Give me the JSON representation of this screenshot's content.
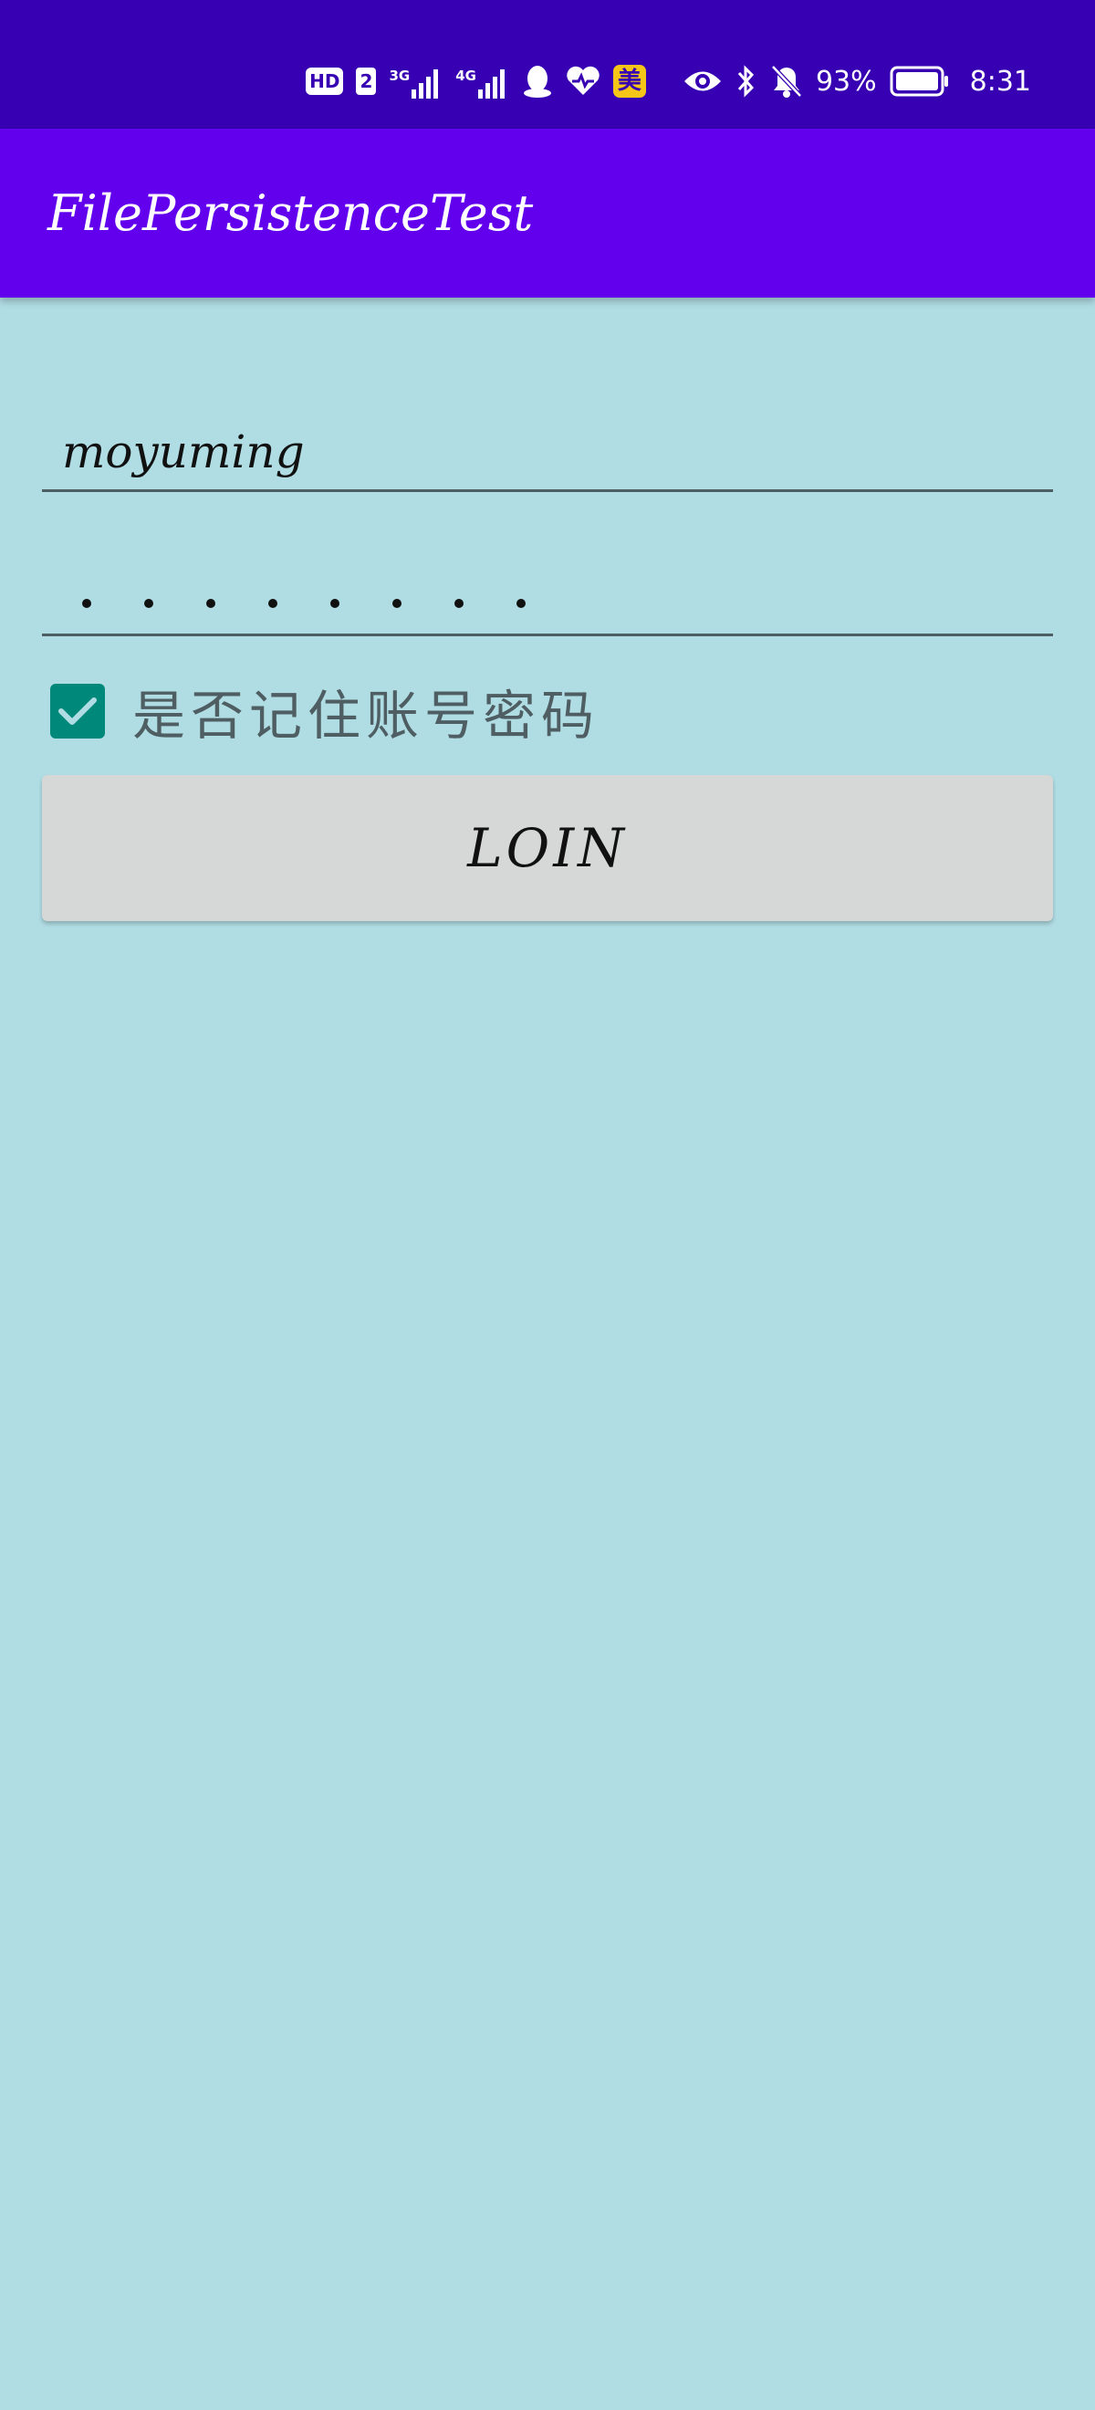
{
  "status_bar": {
    "hd_label": "HD",
    "sim_label": "2",
    "network_1": "3G",
    "network_2": "4G",
    "mei_label": "美",
    "battery": "93%",
    "time": "8:31",
    "icons": [
      "hd-icon",
      "signal-icon",
      "signal-icon",
      "qq-icon",
      "health-heart-icon",
      "meituan-icon",
      "eye-icon",
      "bluetooth-icon",
      "bell-muted-icon",
      "battery-icon"
    ]
  },
  "app_bar": {
    "title": "FilePersistenceTest",
    "color": "#6200ee"
  },
  "form": {
    "username": "moyuming",
    "password_dot_count": 8,
    "remember_label": "是否记住账号密码",
    "remember_checked": true,
    "checkbox_color": "#00897b",
    "login_label": "LOIN"
  },
  "colors": {
    "background": "#b0dde4",
    "status_bar": "#3700b3"
  }
}
